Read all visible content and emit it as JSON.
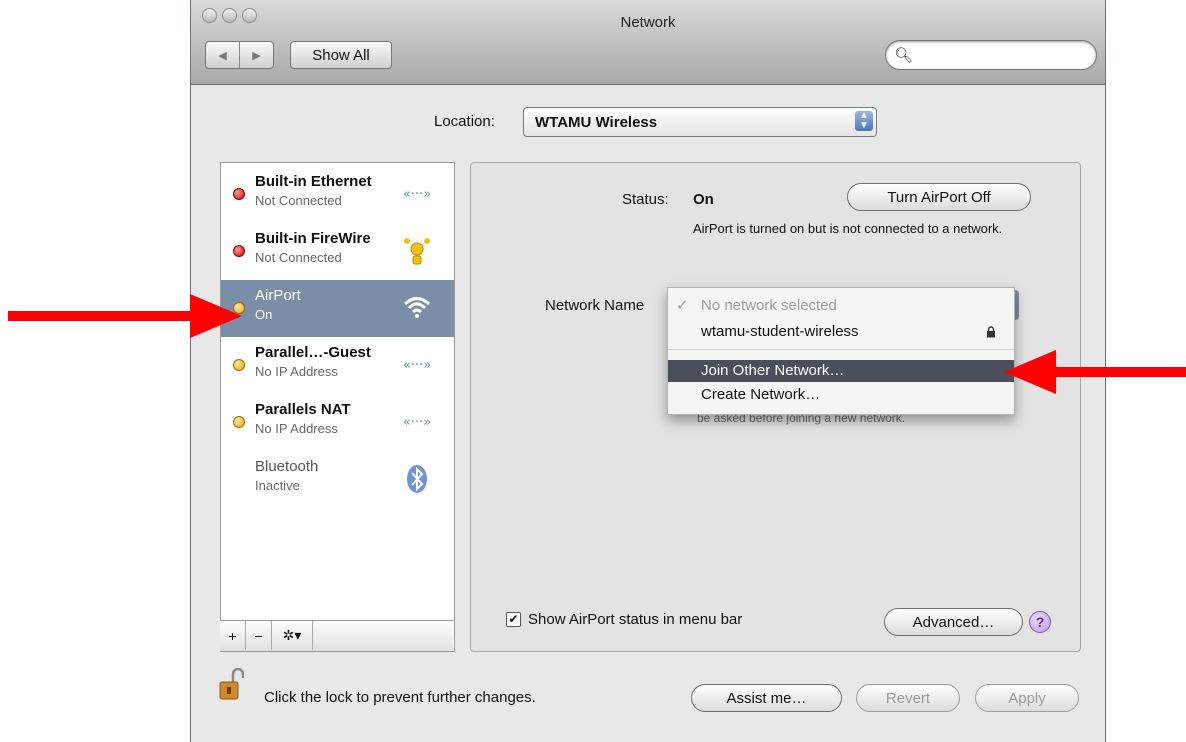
{
  "window": {
    "title": "Network",
    "show_all_label": "Show All",
    "search_placeholder": ""
  },
  "location": {
    "label": "Location:",
    "value": "WTAMU Wireless"
  },
  "services": [
    {
      "name": "Built-in Ethernet",
      "status": "Not Connected",
      "indicator": "red",
      "icon": "ethernet-icon"
    },
    {
      "name": "Built-in FireWire",
      "status": "Not Connected",
      "indicator": "red",
      "icon": "firewire-icon"
    },
    {
      "name": "AirPort",
      "status": "On",
      "indicator": "amber",
      "icon": "wifi-icon",
      "selected": true
    },
    {
      "name": "Parallel…-Guest",
      "status": "No IP Address",
      "indicator": "amber",
      "icon": "ethernet-icon"
    },
    {
      "name": "Parallels NAT",
      "status": "No IP Address",
      "indicator": "amber",
      "icon": "ethernet-icon"
    },
    {
      "name": "Bluetooth",
      "status": "Inactive",
      "indicator": "none",
      "icon": "bluetooth-icon"
    }
  ],
  "sidebar_toolbar": {
    "add": "+",
    "remove": "−",
    "action": "✲▾"
  },
  "detail": {
    "status_label": "Status:",
    "status_value": "On",
    "turn_off_label": "Turn AirPort Off",
    "status_description": "AirPort is turned on but is not connected to a network.",
    "network_name_label": "Network Name",
    "behind_menu_text": "be asked before joining a new network."
  },
  "network_menu": {
    "items": [
      {
        "label": "No network selected",
        "checked": true,
        "disabled": true
      },
      {
        "label": "wtamu-student-wireless",
        "locked": true
      },
      {
        "label": "Join Other Network…",
        "highlighted": true
      },
      {
        "label": "Create Network…"
      }
    ]
  },
  "footer": {
    "show_status_label": "Show AirPort status in menu bar",
    "show_status_checked": true,
    "advanced_label": "Advanced…",
    "help_label": "?",
    "lock_text": "Click the lock to prevent further changes.",
    "assist_label": "Assist me…",
    "revert_label": "Revert",
    "apply_label": "Apply"
  },
  "colors": {
    "annotation_arrow": "#ff0000",
    "selected_row": "#7a8ea8",
    "menu_highlight": "#4a4f5a"
  }
}
